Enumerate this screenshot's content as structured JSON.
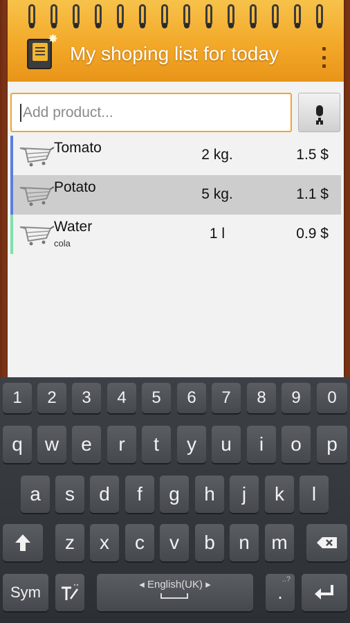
{
  "header": {
    "title": "My shoping list for today"
  },
  "input": {
    "placeholder": "Add product..."
  },
  "products": [
    {
      "name": "Tomato",
      "note": "",
      "qty": "2 kg.",
      "price": "1.5 $"
    },
    {
      "name": "Potato",
      "note": "",
      "qty": "5 kg.",
      "price": "1.1 $"
    },
    {
      "name": "Water",
      "note": "cola",
      "qty": "1 l",
      "price": "0.9 $"
    }
  ],
  "keyboard": {
    "row_numbers": [
      "1",
      "2",
      "3",
      "4",
      "5",
      "6",
      "7",
      "8",
      "9",
      "0"
    ],
    "row1": [
      "q",
      "w",
      "e",
      "r",
      "t",
      "y",
      "u",
      "i",
      "o",
      "p"
    ],
    "row2": [
      "a",
      "s",
      "d",
      "f",
      "g",
      "h",
      "j",
      "k",
      "l"
    ],
    "row3": [
      "z",
      "x",
      "c",
      "v",
      "b",
      "n",
      "m"
    ],
    "sym": "Sym",
    "space_label": "English(UK)",
    "period": ".",
    "period_hint": "..?"
  },
  "colors": {
    "accent": "#f2a626",
    "row_blue": "#5a7ee0",
    "row_green": "#7de0a8"
  }
}
